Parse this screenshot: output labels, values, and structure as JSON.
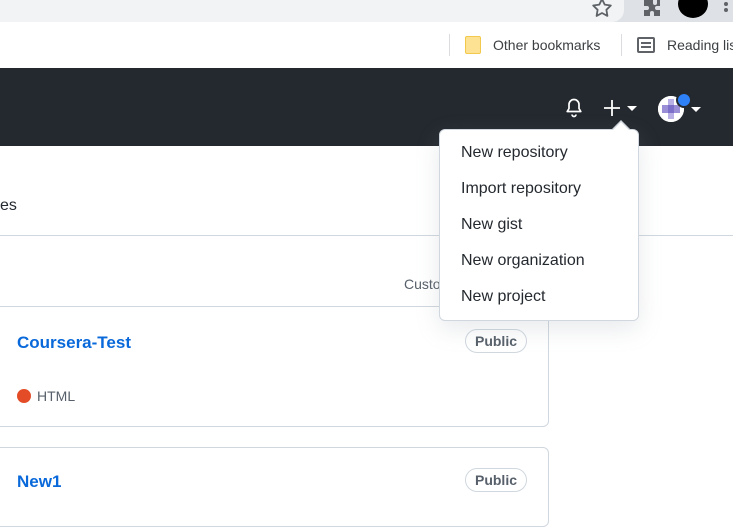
{
  "browser": {
    "bookmarks": [
      {
        "label": "Other bookmarks",
        "icon": "folder-icon"
      },
      {
        "label": "Reading list",
        "icon": "reading-list-icon"
      }
    ]
  },
  "header": {
    "icons": [
      "bell-icon",
      "plus-icon",
      "caret-down-icon",
      "avatar"
    ],
    "colors": {
      "background": "#24292f",
      "notification_dot": "#2f81f7"
    }
  },
  "page": {
    "tab_fragment": "es",
    "customize_fragment": "Custo"
  },
  "repos": [
    {
      "name": "Coursera-Test",
      "visibility": "Public",
      "language": "HTML",
      "language_color": "#e34c26"
    },
    {
      "name": "New1",
      "visibility": "Public"
    }
  ],
  "dropdown": {
    "items": [
      "New repository",
      "Import repository",
      "New gist",
      "New organization",
      "New project"
    ]
  }
}
